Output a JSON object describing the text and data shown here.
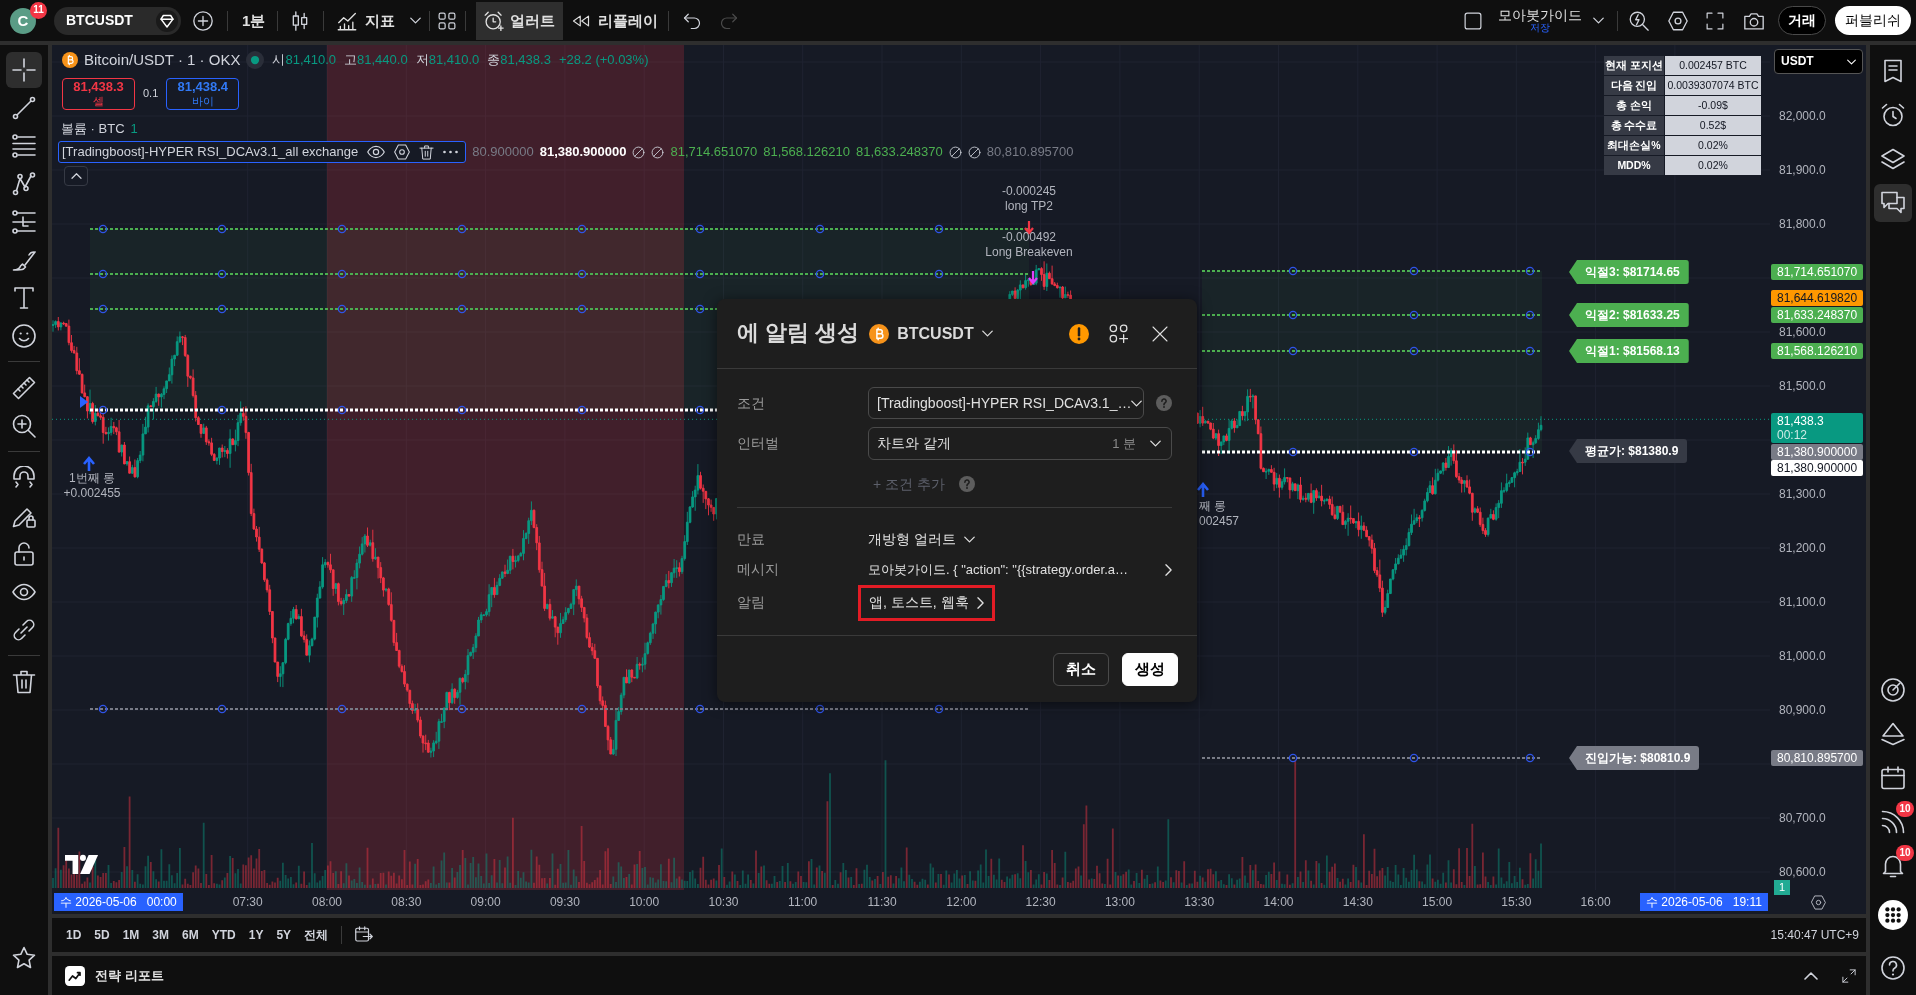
{
  "top_bar": {
    "avatar": {
      "letter": "C",
      "badge": "11"
    },
    "symbol": "BTCUSDT",
    "interval": "1분",
    "indicators": "지표",
    "alert": {
      "label": "얼러트",
      "selected": true
    },
    "replay": "리플레이",
    "undo": {
      "disabled": false
    },
    "redo": {
      "disabled": true
    },
    "layout": {
      "name": "모아봇가이드",
      "status": "저장"
    },
    "trade": "거래",
    "publish": "퍼블리쉬"
  },
  "left_toolbar": {
    "tools": [
      {
        "selected": true
      },
      {
        "selected": false
      },
      {
        "selected": false
      },
      {
        "selected": false
      },
      {
        "selected": false
      },
      {
        "selected": false
      },
      {
        "selected": false
      },
      {
        "selected": false
      },
      {
        "selected": false
      },
      {
        "selected": false
      },
      {
        "selected": false
      },
      {
        "selected": false
      },
      {
        "selected": false
      },
      {
        "selected": false
      },
      {
        "selected": false
      },
      {
        "selected": false
      },
      {
        "selected": false
      }
    ]
  },
  "right_toolbar": {
    "items": [
      {
        "selected": false
      },
      {
        "selected": false
      },
      {
        "selected": false
      },
      {
        "selected": true
      },
      {
        "selected": false
      },
      {
        "selected": false
      },
      {
        "selected": false
      },
      {
        "selected": false,
        "badge": "10"
      },
      {
        "selected": false,
        "badge": "10"
      },
      {
        "selected": false
      },
      {
        "selected": false
      }
    ]
  },
  "legend": {
    "title": "Bitcoin/USDT · 1 · OKX",
    "market_open": true,
    "ohlc": [
      {
        "label": "시",
        "value": "81,410.0"
      },
      {
        "label": "고",
        "value": "81,440.0"
      },
      {
        "label": "저",
        "value": "81,410.0"
      },
      {
        "label": "종",
        "value": "81,438.3"
      }
    ],
    "change": "+28.2 (+0.03%)",
    "sell": {
      "price": "81,438.3",
      "label": "셀"
    },
    "spread": "0.1",
    "buy": {
      "price": "81,438.4",
      "label": "바이"
    },
    "volume": {
      "label": "볼륨 · BTC",
      "value": "1"
    }
  },
  "indicator": {
    "name": "[Tradingboost]-HYPER RSI_DCAv3.1_all exchange",
    "values": [
      {
        "kind": "value",
        "text": "80.900000",
        "color": "#787b86",
        "bold": false
      },
      {
        "kind": "value",
        "text": "81,380.900000",
        "color": "#ffffff",
        "bold": true
      },
      {
        "kind": "na"
      },
      {
        "kind": "na"
      },
      {
        "kind": "value",
        "text": "81,714.651070",
        "color": "#4caf50",
        "bold": false
      },
      {
        "kind": "value",
        "text": "81,568.126210",
        "color": "#4caf50",
        "bold": false
      },
      {
        "kind": "value",
        "text": "81,633.248370",
        "color": "#4caf50",
        "bold": false
      },
      {
        "kind": "na"
      },
      {
        "kind": "na"
      },
      {
        "kind": "value",
        "text": "80,810.895700",
        "color": "#787b86",
        "bold": false
      }
    ]
  },
  "position_table": {
    "rows": [
      {
        "label": "현재 포지션",
        "value": "0.002457 BTC"
      },
      {
        "label": "다음 진입",
        "value": "0.0039307074 BTC"
      },
      {
        "label": "총 손익",
        "value": "-0.09$"
      },
      {
        "label": "총 수수료",
        "value": "0.52$"
      },
      {
        "label": "최대손실%",
        "value": "0.02%"
      },
      {
        "label": "MDD%",
        "value": "0.02%"
      }
    ]
  },
  "currency": "USDT",
  "price_axis": {
    "ticks": [
      "82,000.0",
      "81,900.0",
      "81,800.0",
      "81,600.0",
      "81,500.0",
      "81,300.0",
      "81,200.0",
      "81,100.0",
      "81,000.0",
      "80,900.0",
      "80,700.0",
      "80,600.0"
    ],
    "labels": [
      {
        "text": "81,714.651070",
        "color": "#4caf50"
      },
      {
        "text": "81,644.619820",
        "color": "#ff9800"
      },
      {
        "text": "81,633.248370",
        "color": "#4caf50"
      },
      {
        "text": "81,568.126210",
        "color": "#4caf50"
      },
      {
        "text": "81,438.3",
        "countdown": "00:12",
        "color": "#089981"
      },
      {
        "text": "81,380.900000",
        "color": "#787b86"
      },
      {
        "text": "81,380.900000",
        "color": "#ffffff"
      },
      {
        "text": "80,810.895700",
        "color": "#787b86"
      }
    ]
  },
  "plot_labels": [
    {
      "text": "익절3: $81714.65",
      "color": "#4caf50"
    },
    {
      "text": "익절2: $81633.25",
      "color": "#4caf50"
    },
    {
      "text": "익절1: $81568.13",
      "color": "#4caf50"
    },
    {
      "text": "평균가: $81380.9",
      "color": "#363a45"
    },
    {
      "text": "진입가능: $80810.9",
      "color": "#787b86"
    }
  ],
  "trade_marks": [
    {
      "lines": [
        "1번째 롱",
        "+0.002455"
      ]
    },
    {
      "lines": [
        "째 롱",
        "002457"
      ]
    },
    {
      "lines": [
        "-0.000245",
        "long TP2"
      ]
    },
    {
      "lines": [
        "-0.000492",
        "Long Breakeven"
      ]
    }
  ],
  "volume_badge": "1",
  "time_axis": {
    "start": "수 2026-05-06   00:00",
    "ticks": [
      "07:30",
      "08:00",
      "08:30",
      "09:00",
      "09:30",
      "10:00",
      "10:30",
      "11:00",
      "11:30",
      "12:00",
      "12:30",
      "13:00",
      "13:30",
      "14:00",
      "14:30",
      "15:00",
      "15:30",
      "16:00"
    ],
    "cursor": "수 2026-05-06   19:11"
  },
  "range_bar": {
    "ranges": [
      "1D",
      "5D",
      "1M",
      "3M",
      "6M",
      "YTD",
      "1Y",
      "5Y",
      "전체"
    ],
    "clock": "15:40:47 UTC+9"
  },
  "bottom_panel": {
    "title": "전략 리포트"
  },
  "alert_dialog": {
    "title": "에 알림 생성",
    "symbol": "BTCUSDT",
    "condition": {
      "label": "조건",
      "value": "[Tradingboost]-HYPER RSI_DCAv3.1_…"
    },
    "interval": {
      "label": "인터벌",
      "value": "차트와 같게",
      "hint": "1 분"
    },
    "add_condition": {
      "label": "+ 조건 추가",
      "disabled": true
    },
    "expiry": {
      "label": "만료",
      "value": "개방형 얼러트"
    },
    "message": {
      "label": "메시지",
      "value": "모아봇가이드. { \"action\": \"{{strategy.order.a…"
    },
    "notifications": {
      "label": "알림",
      "value": "앱, 토스트, 웹훅",
      "highlighted": true
    },
    "buttons": [
      {
        "label": "취소",
        "kind": "secondary"
      },
      {
        "label": "생성",
        "kind": "primary"
      }
    ]
  }
}
